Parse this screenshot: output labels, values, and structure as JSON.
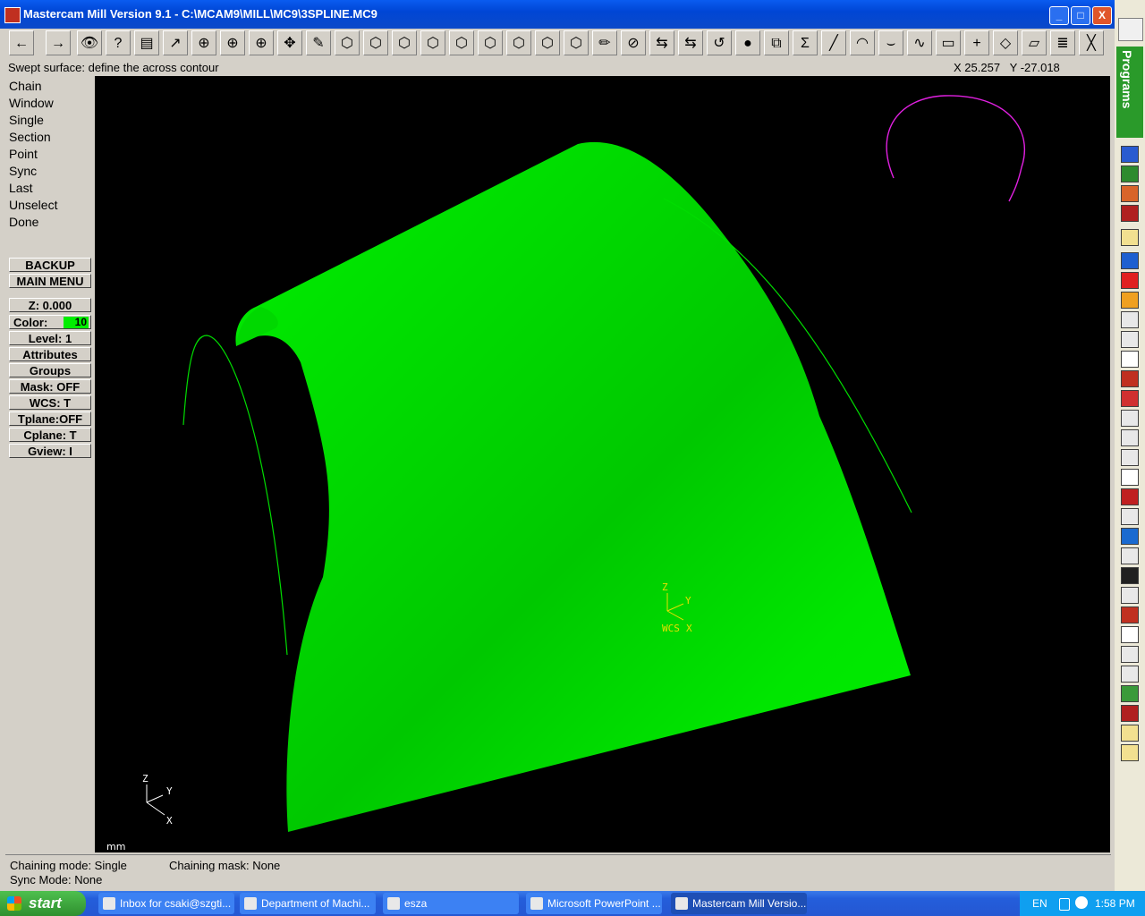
{
  "window": {
    "title": "Mastercam Mill Version 9.1 - C:\\MCAM9\\MILL\\MC9\\3SPLINE.MC9",
    "minimize_label": "_",
    "maximize_label": "□",
    "close_label": "X"
  },
  "toolbar": {
    "buttons": [
      "←",
      "→",
      "👁",
      "?",
      "▤",
      "↗",
      "⊕",
      "⊕",
      "⊕",
      "✥",
      "✎",
      "⬡",
      "⬡",
      "⬡",
      "⬡",
      "⬡",
      "⬡",
      "⬡",
      "⬡",
      "⬡",
      "✏",
      "⊘",
      "⇆",
      "⇆",
      "↺",
      "●",
      "⧉",
      "Σ",
      "╱",
      "◠",
      "⌣",
      "∿",
      "▭",
      "+",
      "◇",
      "▱",
      "≣",
      "╳"
    ]
  },
  "prompt": "Swept surface: define the across contour",
  "coords": "X 25.257   Y -27.018",
  "menu": {
    "items": [
      "Chain",
      "Window",
      "Single",
      "Section",
      "Point",
      "Sync",
      "Last",
      "Unselect",
      "Done"
    ],
    "backup": "BACKUP",
    "main_menu": "MAIN MENU"
  },
  "params": {
    "z": "Z:   0.000",
    "color_label": "Color:",
    "color_value": "10",
    "level": "Level:  1",
    "attributes": "Attributes",
    "groups": "Groups",
    "mask": "Mask:  OFF",
    "wcs": "WCS:   T",
    "tplane": "Tplane:OFF",
    "cplane": "Cplane:  T",
    "gview": "Gview:   I"
  },
  "viewport": {
    "wcs_z": "Z",
    "wcs_y": "Y",
    "wcs_label": "WCS",
    "wcs_x": "X",
    "axis_z": "Z",
    "axis_y": "Y",
    "axis_x": "X",
    "units": "mm",
    "surface_color": "#00e000",
    "curve_color": "#00dd00",
    "magenta_color": "#e020e0",
    "wcs_color": "#e8e000"
  },
  "status": {
    "chaining_mode": "Chaining mode: Single",
    "chaining_mask": "Chaining mask: None",
    "sync_mode": "Sync Mode: None"
  },
  "rightbar": {
    "label": "Programs"
  },
  "taskbar": {
    "start": "start",
    "tasks": [
      "Inbox for csaki@szgti...",
      "Department of Machi...",
      "esza",
      "Microsoft PowerPoint ...",
      "Mastercam Mill Versio..."
    ],
    "lang": "EN",
    "clock": "1:58 PM"
  }
}
